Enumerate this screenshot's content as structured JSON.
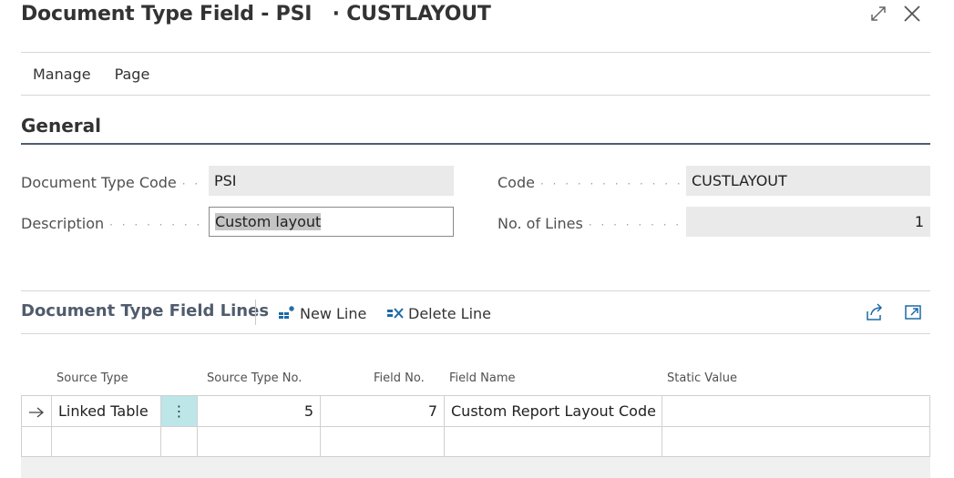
{
  "window": {
    "title": "Document Type Field - PSI   · CUSTLAYOUT",
    "expand_icon": "expand-icon",
    "close_icon": "close-icon"
  },
  "action_bar": {
    "items": [
      {
        "label": "Manage"
      },
      {
        "label": "Page"
      }
    ]
  },
  "general": {
    "title": "General",
    "document_type_code": {
      "label": "Document Type Code",
      "value": "PSI"
    },
    "description": {
      "label": "Description",
      "value": "Custom layout"
    },
    "code": {
      "label": "Code",
      "value": "CUSTLAYOUT"
    },
    "no_of_lines": {
      "label": "No. of Lines",
      "value": "1"
    }
  },
  "lines": {
    "title": "Document Type Field Lines",
    "new_line_label": "New Line",
    "delete_line_label": "Delete Line",
    "share_icon": "share-icon",
    "open_new_icon": "open-in-new-window-icon",
    "columns": [
      "Source Type",
      "Source Type No.",
      "Field No.",
      "Field Name",
      "Static Value"
    ],
    "rows": [
      {
        "source_type": "Linked Table",
        "source_type_no": "5",
        "field_no": "7",
        "field_name": "Custom Report Layout Code",
        "static_value": ""
      },
      {
        "source_type": "",
        "source_type_no": "",
        "field_no": "",
        "field_name": "",
        "static_value": ""
      }
    ]
  },
  "colors": {
    "accent": "#505c6d",
    "selected_cell": "#bde6e9",
    "field_bg": "#eaeaea"
  }
}
